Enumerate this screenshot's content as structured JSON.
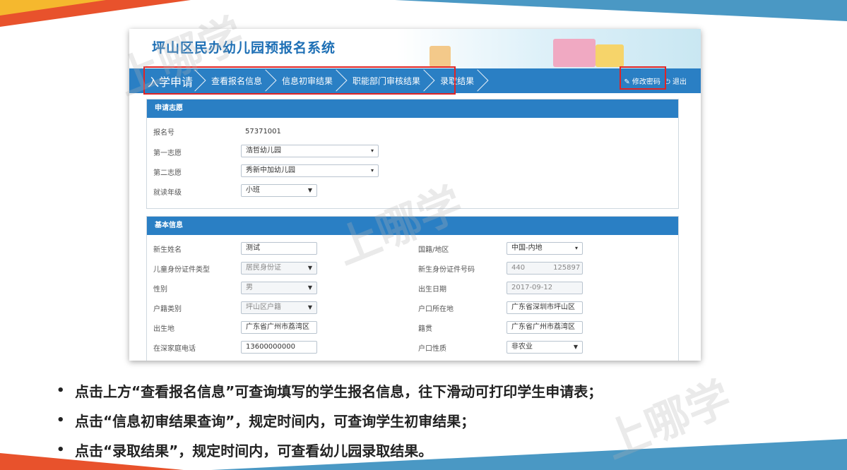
{
  "system_title": "坪山区民办幼儿园预报名系统",
  "nav": {
    "items": [
      "入学申请",
      "查看报名信息",
      "信息初审结果",
      "职能部门审核结果",
      "录取结果"
    ],
    "change_password": "修改密码",
    "logout": "退出"
  },
  "application": {
    "header": "申请志愿",
    "reg_no_label": "报名号",
    "reg_no": "57371001",
    "choice1_label": "第一志愿",
    "choice1": "浩哲幼儿园",
    "choice2_label": "第二志愿",
    "choice2": "秀新中加幼儿园",
    "grade_label": "就读年级",
    "grade": "小班"
  },
  "basic": {
    "header": "基本信息",
    "name_label": "新生姓名",
    "name": "测试",
    "id_type_label": "儿童身份证件类型",
    "id_type": "居民身份证",
    "gender_label": "性别",
    "gender": "男",
    "hukou_type_label": "户籍类别",
    "hukou_type": "坪山区户籍",
    "birthplace_label": "出生地",
    "birthplace": "广东省广州市荔湾区",
    "phone_label": "在深家庭电话",
    "phone": "13600000000",
    "nationality_label": "国籍/地区",
    "nationality": "中国-内地",
    "id_no_label": "新生身份证件号码",
    "id_no": "440    125897",
    "birthdate_label": "出生日期",
    "birthdate": "2017-09-12",
    "hukou_place_label": "户口所在地",
    "hukou_place": "广东省深圳市坪山区",
    "native_label": "籍贯",
    "native": "广东省广州市荔湾区",
    "hukou_nature_label": "户口性质",
    "hukou_nature": "非农业"
  },
  "bullets": [
    "点击上方“查看报名信息”可查询填写的学生报名信息，往下滑动可打印学生申请表；",
    "点击“信息初审结果查询”，规定时间内，可查询学生初审结果；",
    "点击“录取结果”，规定时间内，可查看幼儿园录取结果。"
  ],
  "watermark": "上哪学",
  "colors": {
    "nav_blue": "#2a7fc4",
    "title_blue": "#1d6fb5",
    "highlight_red": "#e02424"
  }
}
